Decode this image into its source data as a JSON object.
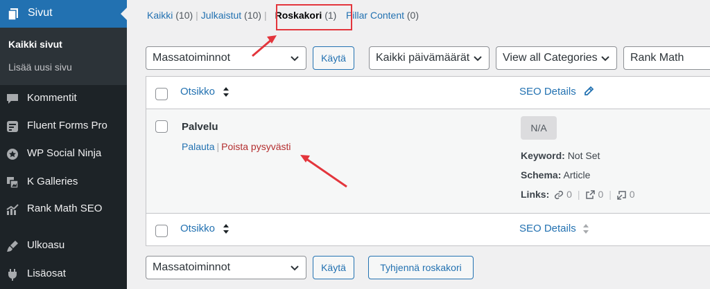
{
  "sidebar": {
    "top_item": {
      "label": "Sivut",
      "icon": "pages-icon"
    },
    "submenu": [
      {
        "label": "Kaikki sivut",
        "current": true
      },
      {
        "label": "Lisää uusi sivu",
        "current": false
      }
    ],
    "items": [
      {
        "label": "Kommentit",
        "icon": "comment-icon"
      },
      {
        "label": "Fluent Forms Pro",
        "icon": "forms-icon"
      },
      {
        "label": "WP Social Ninja",
        "icon": "ninja-icon"
      },
      {
        "label": "K Galleries",
        "icon": "gallery-icon"
      },
      {
        "label": "Rank Math SEO",
        "icon": "rank-math-icon"
      },
      {
        "label": "Ulkoasu",
        "icon": "brush-icon"
      },
      {
        "label": "Lisäosat",
        "icon": "plugin-icon"
      }
    ]
  },
  "tabs": [
    {
      "label": "Kaikki",
      "count": "(10)"
    },
    {
      "label": "Julkaistut",
      "count": "(10)"
    },
    {
      "label": "Roskakori",
      "count": "(1)"
    },
    {
      "label": "Pillar Content",
      "count": "(0)"
    }
  ],
  "tablenav_top": {
    "bulk_action": "Massatoiminnot",
    "apply": "Käytä",
    "date_filter": "Kaikki päivämäärät",
    "category_filter": "View all Categories",
    "rank_math_filter": "Rank Math"
  },
  "table": {
    "col_title": "Otsikko",
    "col_seo": "SEO Details",
    "row": {
      "title": "Palvelu",
      "action_restore": "Palauta",
      "action_sep": "|",
      "action_delete": "Poista pysyvästi",
      "badge": "N/A",
      "keyword_label": "Keyword:",
      "keyword_value": "Not Set",
      "schema_label": "Schema:",
      "schema_value": "Article",
      "links_label": "Links:",
      "internal_links": "0",
      "external_links": "0",
      "incoming_links": "0"
    }
  },
  "tablenav_bottom": {
    "bulk_action": "Massatoiminnot",
    "apply": "Käytä",
    "empty_trash": "Tyhjennä roskakori"
  },
  "colors": {
    "sidebar_bg": "#1d2327",
    "active_bg": "#2271b1",
    "link": "#2271b1",
    "delete": "#b32d2e",
    "annotation": "#e3353c"
  }
}
